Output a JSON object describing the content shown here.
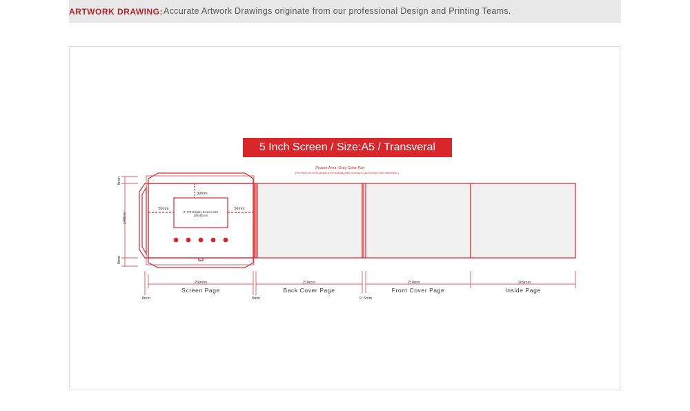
{
  "header": {
    "label": "ARTWORK DRAWING:",
    "text": "Accurate Artwork Drawings originate from our professional Design and Printing Teams.",
    "label_color": "#b0262a"
  },
  "diagram": {
    "title": "5 Inch Screen  /  Size:A5 / Transveral",
    "accent_color": "#d9262b",
    "panel_fill": "#f1f1f1",
    "picture_area": "Picture Area: Gray Color Part",
    "bleed_note": "(The Red Line of the Outside is the Bleeding Area, not easy to put Text and Other Information.)",
    "screen": {
      "line1": "5\" IPS Display Screen Size",
      "line2": "108x60mm",
      "top": "30mm",
      "left": "50mm",
      "right": "50mm"
    },
    "side_dims": [
      "8mm",
      "148mm",
      "8mm"
    ],
    "pages": [
      {
        "width": "209mm",
        "name": "Screen Page"
      },
      {
        "width": "210mm",
        "name": "Back Cover Page"
      },
      {
        "width": "210mm",
        "name": "Front Cover Page"
      },
      {
        "width": "209mm",
        "name": "Inside Page"
      }
    ],
    "gaps": [
      "8mm",
      "8mm",
      "9. 5mm"
    ],
    "button_count": 5
  }
}
